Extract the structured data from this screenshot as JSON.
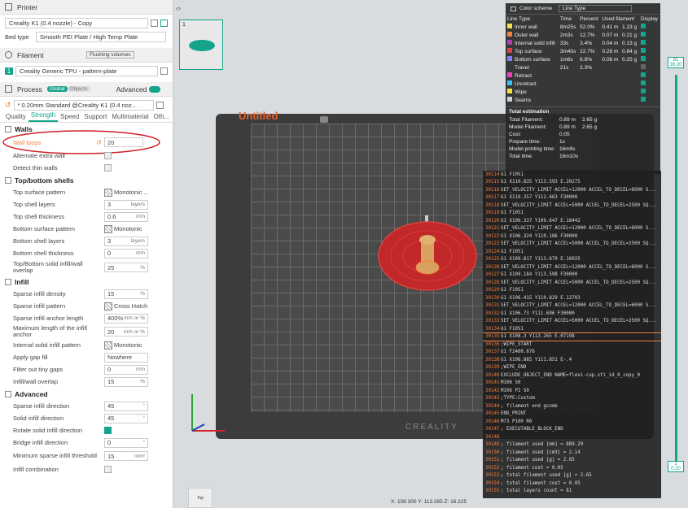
{
  "printer": {
    "section_title": "Printer",
    "name": "Creality K1 (0.4 nozzle) - Copy",
    "bed_type_label": "Bed type",
    "bed_type_value": "Smooth PEI Plate / High Temp Plate"
  },
  "filament": {
    "section_title": "Filament",
    "flushing_label": "Flushing volumes",
    "slot": "1",
    "name": "Creality Generic TPU - pattern-plate"
  },
  "process": {
    "section_title": "Process",
    "global_label": "Global",
    "objects_label": "Objects",
    "advanced_label": "Advanced",
    "preset": "* 0.20mm Standard @Creality K1 (0.4 noz..."
  },
  "tabs": [
    "Quality",
    "Strength",
    "Speed",
    "Support",
    "Multimaterial",
    "Oth..."
  ],
  "walls": {
    "title": "Walls",
    "wall_loops_label": "Wall loops",
    "wall_loops_value": "20",
    "alt_extra_wall": "Alternate extra wall",
    "detect_thin_walls": "Detect thin walls"
  },
  "top_bottom": {
    "title": "Top/bottom shells",
    "rows": [
      {
        "label": "Top surface pattern",
        "value": "Monotonic ..."
      },
      {
        "label": "Top shell layers",
        "value": "3",
        "unit": "layers"
      },
      {
        "label": "Top shell thickness",
        "value": "0.6",
        "unit": "mm"
      },
      {
        "label": "Bottom surface pattern",
        "value": "Monotonic"
      },
      {
        "label": "Bottom shell layers",
        "value": "3",
        "unit": "layers"
      },
      {
        "label": "Bottom shell thickness",
        "value": "0",
        "unit": "mm"
      },
      {
        "label": "Top/Bottom solid infill/wall overlap",
        "value": "25",
        "unit": "%"
      }
    ]
  },
  "infill": {
    "title": "Infill",
    "rows": [
      {
        "label": "Sparse infill density",
        "value": "15",
        "unit": "%"
      },
      {
        "label": "Sparse infill pattern",
        "value": "Cross Hatch"
      },
      {
        "label": "Sparse infill anchor length",
        "value": "400%",
        "unit": "mm or %"
      },
      {
        "label": "Maximum length of the infill anchor",
        "value": "20",
        "unit": "mm or %"
      },
      {
        "label": "Internal solid infill pattern",
        "value": "Monotonic"
      },
      {
        "label": "Apply gap fill",
        "value": "Nowhere"
      },
      {
        "label": "Filter out tiny gaps",
        "value": "0",
        "unit": "mm"
      },
      {
        "label": "Infill/wall overlap",
        "value": "15",
        "unit": "%"
      }
    ]
  },
  "advanced": {
    "title": "Advanced",
    "rows": [
      {
        "label": "Sparse infill direction",
        "value": "45",
        "unit": "°"
      },
      {
        "label": "Solid infill direction",
        "value": "45",
        "unit": "°"
      },
      {
        "label": "Rotate solid infill direction",
        "value": ""
      },
      {
        "label": "Bridge infill direction",
        "value": "0",
        "unit": "°"
      },
      {
        "label": "Minimum sparse infill threshold",
        "value": "15",
        "unit": "mm²"
      },
      {
        "label": "Infill combination",
        "value": ""
      }
    ]
  },
  "viewport": {
    "plate_title": "Untitled",
    "brand": "CREALITY",
    "plate_number": "1",
    "view_label": "Top",
    "coords": "X: 108.300  Y: 113.265  Z: 16.225",
    "slider_top_layer": "81",
    "slider_top_height": "16.20",
    "slider_bottom_layer": "1",
    "slider_bottom_height": "0.20"
  },
  "color_scheme": {
    "title": "Color scheme",
    "mode": "Line Type",
    "headers": [
      "Line Type",
      "Time",
      "Percent",
      "Used filament",
      "Display"
    ],
    "rows": [
      {
        "name": "Inner wall",
        "color": "#f5e050",
        "time": "8m25s",
        "percent": "52.0%",
        "len": "0.41 m",
        "weight": "1.23 g"
      },
      {
        "name": "Outer wall",
        "color": "#f08040",
        "time": "2m3s",
        "percent": "12.7%",
        "len": "0.07 m",
        "weight": "0.21 g"
      },
      {
        "name": "Internal solid infill",
        "color": "#b040b0",
        "time": "33s",
        "percent": "3.4%",
        "len": "0.04 m",
        "weight": "0.13 g"
      },
      {
        "name": "Top surface",
        "color": "#e04040",
        "time": "3m40s",
        "percent": "22.7%",
        "len": "0.28 m",
        "weight": "0.84 g"
      },
      {
        "name": "Bottom surface",
        "color": "#8080f0",
        "time": "1m6s",
        "percent": "6.8%",
        "len": "0.08 m",
        "weight": "0.25 g"
      },
      {
        "name": "Travel",
        "color": "",
        "time": "21s",
        "percent": "2.3%",
        "len": "",
        "weight": ""
      },
      {
        "name": "Retract",
        "color": "#f040c0",
        "time": "",
        "percent": "",
        "len": "",
        "weight": ""
      },
      {
        "name": "Unretract",
        "color": "#40c0f0",
        "time": "",
        "percent": "",
        "len": "",
        "weight": ""
      },
      {
        "name": "Wipe",
        "color": "#f0e040",
        "time": "",
        "percent": "",
        "len": "",
        "weight": ""
      },
      {
        "name": "Seams",
        "color": "#d0d0d0",
        "time": "",
        "percent": "",
        "len": "",
        "weight": ""
      }
    ],
    "total_title": "Total estimation",
    "totals": [
      {
        "label": "Total Filament:",
        "v1": "0.89 m",
        "v2": "2.65 g"
      },
      {
        "label": "Model Filament:",
        "v1": "0.89 m",
        "v2": "2.65 g"
      },
      {
        "label": "Cost:",
        "v1": "0.05",
        "v2": ""
      },
      {
        "label": "Prepare time:",
        "v1": "1s",
        "v2": ""
      },
      {
        "label": "Model printing time:",
        "v1": "16m9s",
        "v2": ""
      },
      {
        "label": "Total time:",
        "v1": "16m10s",
        "v2": ""
      }
    ]
  },
  "gcode": [
    {
      "n": "30114",
      "c": "G1 F1051"
    },
    {
      "n": "30115",
      "c": "G1 X110.835 Y113.593 E.20275"
    },
    {
      "n": "30116",
      "c": "SET_VELOCITY_LIMIT ACCEL=12000 ACCEL_TO_DECEL=6000 S..."
    },
    {
      "n": "30117",
      "c": "G1 X110.357 Y112.663 F30000"
    },
    {
      "n": "30118",
      "c": "SET_VELOCITY_LIMIT ACCEL=5000 ACCEL_TO_DECEL=2500 SQ..."
    },
    {
      "n": "30119",
      "c": "G1 F1051"
    },
    {
      "n": "30120",
      "c": "G1 X106.337 Y109.647 E.18442"
    },
    {
      "n": "30121",
      "c": "SET_VELOCITY_LIMIT ACCEL=12000 ACCEL_TO_DECEL=6000 S..."
    },
    {
      "n": "30122",
      "c": "G1 X106.324 Y110.186 F30000"
    },
    {
      "n": "30123",
      "c": "SET_VELOCITY_LIMIT ACCEL=5000 ACCEL_TO_DECEL=2500 SQ..."
    },
    {
      "n": "30124",
      "c": "G1 F1051"
    },
    {
      "n": "30125",
      "c": "G1 X109.817 Y113.679 E.16025"
    },
    {
      "n": "30126",
      "c": "SET_VELOCITY_LIMIT ACCEL=12000 ACCEL_TO_DECEL=6000 S..."
    },
    {
      "n": "30127",
      "c": "G1 X109.184 Y113.598 F30000"
    },
    {
      "n": "30128",
      "c": "SET_VELOCITY_LIMIT ACCEL=5000 ACCEL_TO_DECEL=2500 SQ..."
    },
    {
      "n": "30129",
      "c": "G1 F1051"
    },
    {
      "n": "30130",
      "c": "G1 X106.415 Y110.829 E.12703"
    },
    {
      "n": "30131",
      "c": "SET_VELOCITY_LIMIT ACCEL=12000 ACCEL_TO_DECEL=6000 S..."
    },
    {
      "n": "30132",
      "c": "G1 X106.73 Y111.696 F30000"
    },
    {
      "n": "30133",
      "c": "SET_VELOCITY_LIMIT ACCEL=5000 ACCEL_TO_DECEL=2500 SQ..."
    },
    {
      "n": "30134",
      "c": "G1 F1051"
    },
    {
      "n": "30135",
      "c": "G1 X108.3 Y113.265 E.07198"
    },
    {
      "n": "30136",
      "c": ";WIPE_START"
    },
    {
      "n": "30137",
      "c": "G1 F2460.876"
    },
    {
      "n": "30138",
      "c": "G1 X106.885 Y111.851 E-.4"
    },
    {
      "n": "30139",
      "c": ";WIPE_END"
    },
    {
      "n": "30140",
      "c": "EXCLUDE_OBJECT_END NAME=flexi-cup.stl_id_0_copy_0"
    },
    {
      "n": "30141",
      "c": "M106 S0"
    },
    {
      "n": "30142",
      "c": "M106 P2 S0"
    },
    {
      "n": "30143",
      "c": ";TYPE:Custom"
    },
    {
      "n": "30144",
      "c": "; filament end gcode"
    },
    {
      "n": "30145",
      "c": "END_PRINT"
    },
    {
      "n": "30146",
      "c": "M73 P100 R0"
    },
    {
      "n": "30147",
      "c": "; EXECUTABLE_BLOCK_END"
    },
    {
      "n": "30148",
      "c": ""
    },
    {
      "n": "30149",
      "c": "; filament used [mm] = 889.29"
    },
    {
      "n": "30150",
      "c": "; filament used [cm3] = 2.14"
    },
    {
      "n": "30151",
      "c": "; filament used [g] = 2.65"
    },
    {
      "n": "30152",
      "c": "; filament cost = 0.05"
    },
    {
      "n": "30153",
      "c": "; total filament used [g] = 2.65"
    },
    {
      "n": "30154",
      "c": "; total filament cost = 0.05"
    },
    {
      "n": "30155",
      "c": "; total layers count = 81"
    }
  ]
}
